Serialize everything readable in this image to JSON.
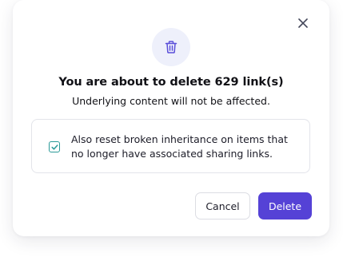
{
  "dialog": {
    "title": "You are about to delete 629 link(s)",
    "subtitle": "Underlying content will not be affected.",
    "header_icon": "trash-icon",
    "close_icon": "close-icon"
  },
  "option": {
    "checked": true,
    "label": "Also reset broken inheritance on items that no longer have associated sharing links.",
    "checkbox_icon": "checkmark-icon"
  },
  "buttons": {
    "cancel_label": "Cancel",
    "delete_label": "Delete"
  },
  "colors": {
    "accent": "#5542d6",
    "icon_circle_bg": "#eef0fb",
    "icon_stroke": "#5a4fd9",
    "checkbox_accent": "#2a9a98"
  }
}
